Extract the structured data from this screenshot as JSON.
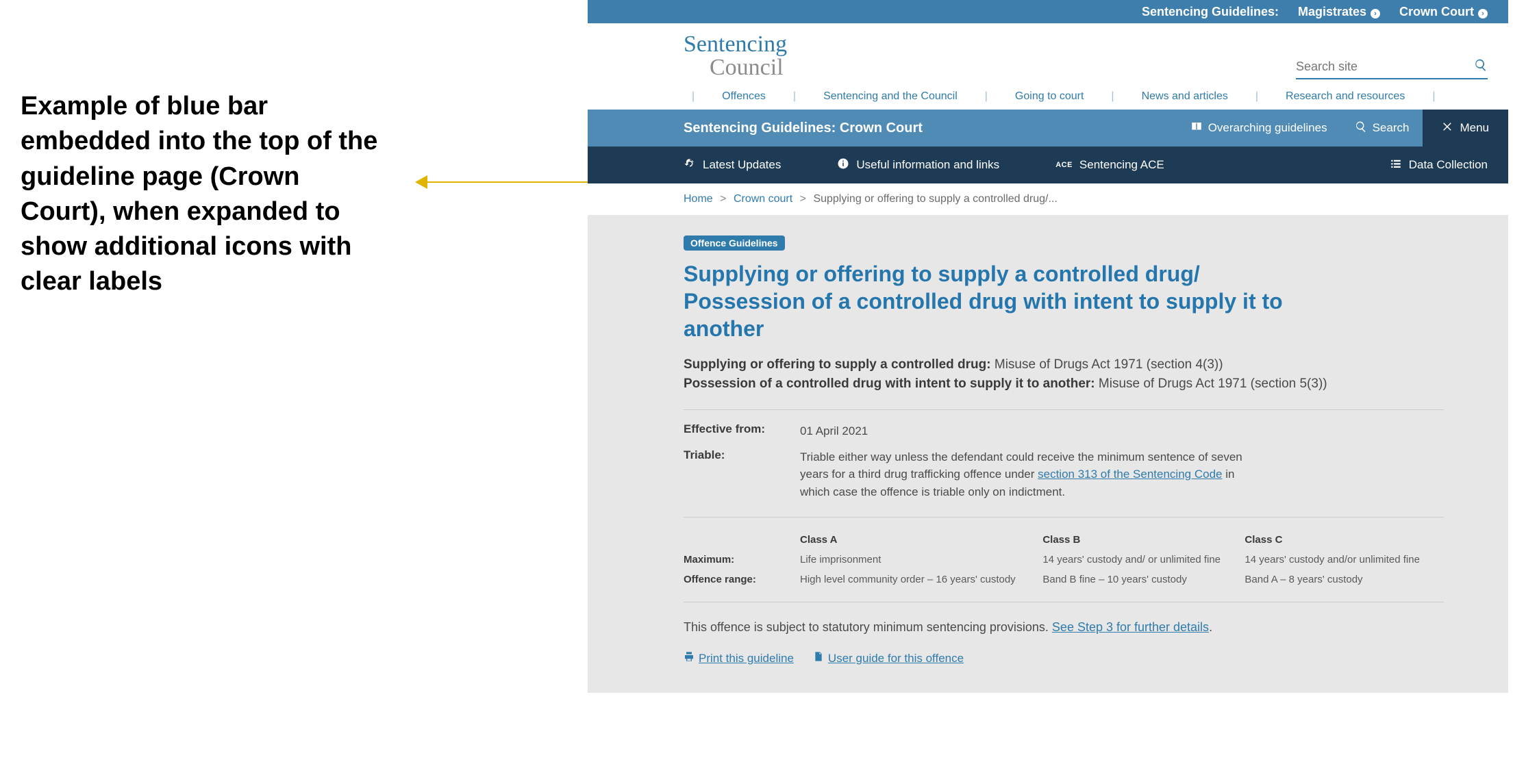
{
  "annotation": "Example of blue bar embedded into the top of the guideline page (Crown Court), when expanded to show additional icons with clear labels",
  "topbar": {
    "prefix": "Sentencing Guidelines:",
    "links": [
      "Magistrates",
      "Crown Court"
    ]
  },
  "logo": {
    "line1": "Sentencing",
    "line2": "Council"
  },
  "search": {
    "placeholder": "Search site"
  },
  "mainnav": [
    "Offences",
    "Sentencing and the Council",
    "Going to court",
    "News and articles",
    "Research and resources"
  ],
  "bluebar": {
    "title": "Sentencing Guidelines: Crown Court",
    "items": [
      {
        "label": "Overarching guidelines",
        "icon": "book"
      },
      {
        "label": "Search",
        "icon": "search"
      },
      {
        "label": "Menu",
        "icon": "close",
        "menu": true
      }
    ]
  },
  "darkbar": [
    {
      "label": "Latest Updates",
      "icon": "refresh"
    },
    {
      "label": "Useful information and links",
      "icon": "info"
    },
    {
      "label": "Sentencing ACE",
      "icon": "ace"
    },
    {
      "label": "Data Collection",
      "icon": "list",
      "last": true
    }
  ],
  "breadcrumbs": {
    "items": [
      "Home",
      "Crown court"
    ],
    "current": "Supplying or offering to supply a controlled drug/..."
  },
  "content": {
    "pill": "Offence Guidelines",
    "title": "Supplying or offering to supply a controlled drug/ Possession of a controlled drug with intent to supply it to another",
    "offences": [
      {
        "bold": "Supplying or offering to supply a controlled drug:",
        "rest": " Misuse of Drugs Act 1971 (section 4(3))"
      },
      {
        "bold": "Possession of a controlled drug with intent to supply it to another:",
        "rest": " Misuse of Drugs Act 1971 (section 5(3))"
      }
    ],
    "effective": {
      "label": "Effective from:",
      "value": "01 April 2021"
    },
    "triable": {
      "label": "Triable:",
      "pretext": "Triable either way unless the defendant could receive the minimum sentence of seven years for a third drug trafficking offence under ",
      "link": "section 313 of the Sentencing Code",
      "posttext": " in which case the offence is triable only on indictment."
    },
    "classtable": {
      "cols": [
        "Class A",
        "Class B",
        "Class C"
      ],
      "rows": [
        {
          "label": "Maximum:",
          "cells": [
            "Life imprisonment",
            "14 years' custody and/ or unlimited fine",
            "14 years' custody and/or unlimited fine"
          ]
        },
        {
          "label": "Offence range:",
          "cells": [
            "High level community order – 16 years' custody",
            "Band B fine – 10 years' custody",
            "Band A – 8 years' custody"
          ]
        }
      ]
    },
    "note_pre": "This offence is subject to statutory minimum sentencing provisions. ",
    "note_link": "See Step 3 for further details",
    "note_post": ".",
    "actions": [
      {
        "label": "Print this guideline",
        "icon": "print"
      },
      {
        "label": "User guide for this offence",
        "icon": "doc"
      }
    ]
  }
}
